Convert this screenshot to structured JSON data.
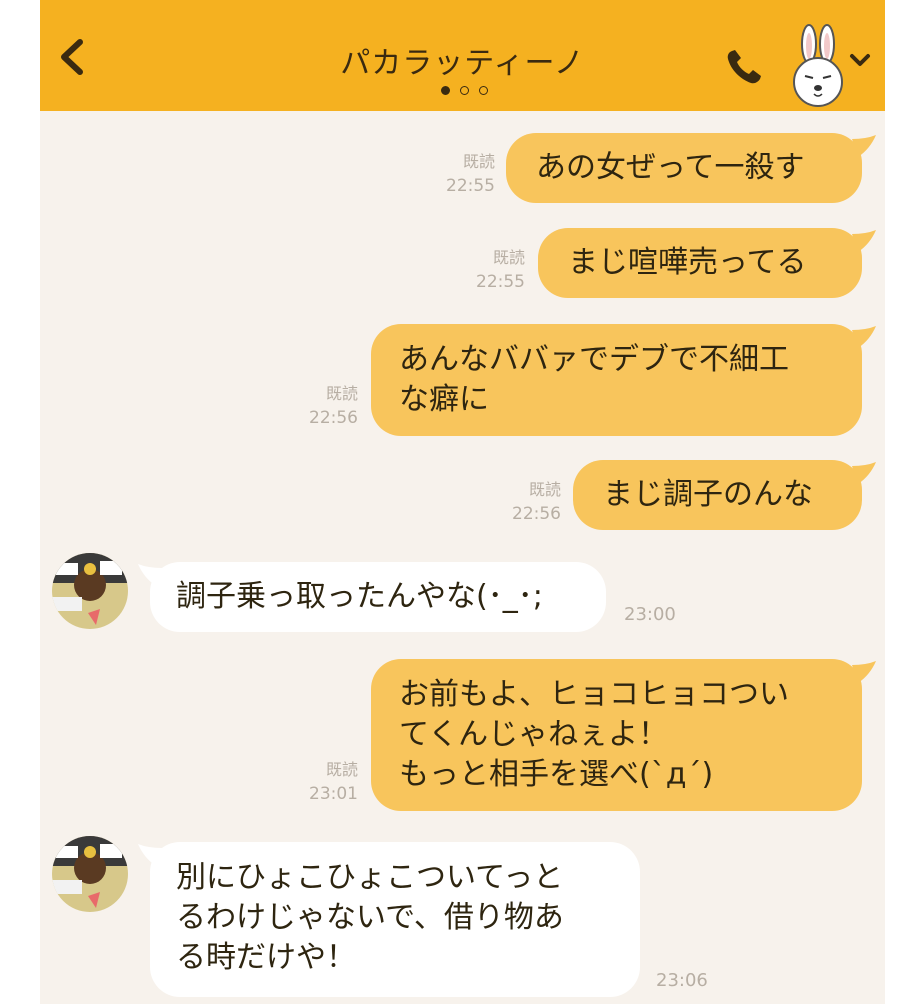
{
  "header": {
    "title": "パカラッティーノ",
    "page_dots": 3,
    "active_dot": 0,
    "back_icon": "chevron-left-icon",
    "call_icon": "phone-icon",
    "menu_icon": "chevron-down-icon",
    "accent_color": "#f5b120"
  },
  "messages": [
    {
      "dir": "out",
      "text": "あの女ぜって一殺す",
      "read": "既読",
      "time": "22:55"
    },
    {
      "dir": "out",
      "text": "まじ喧嘩売ってる",
      "read": "既読",
      "time": "22:55"
    },
    {
      "dir": "out",
      "text": "あんなババァでデブで不細工\nな癖に",
      "read": "既読",
      "time": "22:56"
    },
    {
      "dir": "out",
      "text": "まじ調子のんな",
      "read": "既読",
      "time": "22:56"
    },
    {
      "dir": "in",
      "text": "調子乗っ取ったんやな(･_･;",
      "time": "23:00"
    },
    {
      "dir": "out",
      "text": "お前もよ、ヒョコヒョコつい\nてくんじゃねぇよ！\nもっと相手を選べ(`д´)",
      "read": "既読",
      "time": "23:01"
    },
    {
      "dir": "in",
      "text": "別にひょこひょこついてっと\nるわけじゃないで、借り物あ\nる時だけや！",
      "time": "23:06"
    }
  ]
}
